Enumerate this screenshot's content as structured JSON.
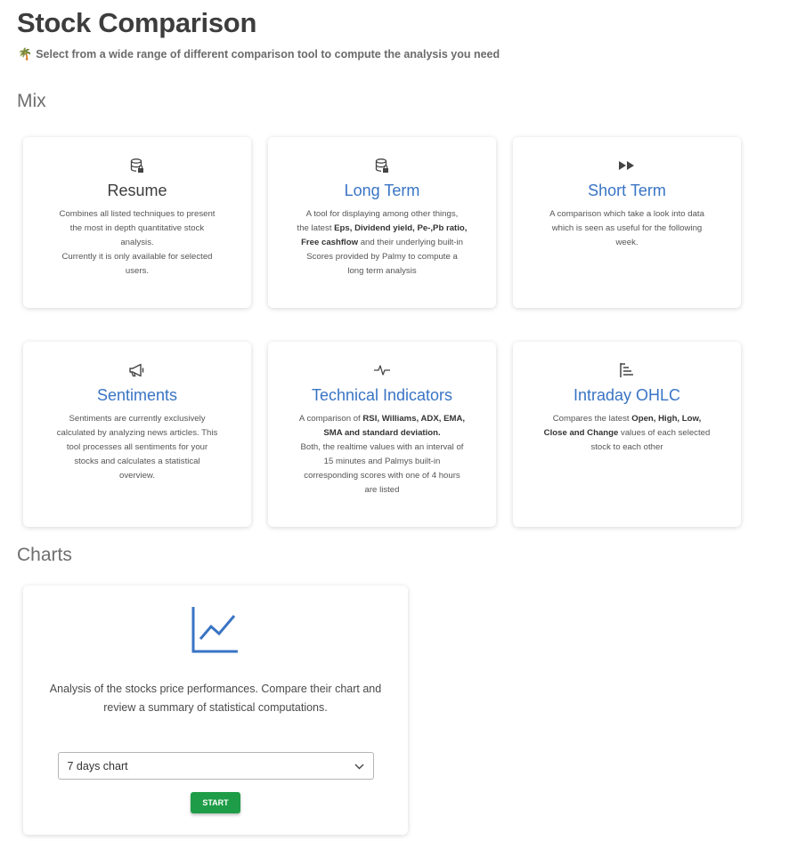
{
  "header": {
    "title": "Stock Comparison",
    "subtitle": "Select from a wide range of different comparison tool to compute the analysis you need"
  },
  "sections": {
    "mix": "Mix",
    "charts": "Charts"
  },
  "mix_cards": [
    {
      "icon": "database-lock-icon",
      "title": "Resume",
      "description_lines": [
        "Combines all listed techniques to present",
        "the most in depth quantitative stock",
        "analysis.",
        "Currently it is only available for selected",
        "users."
      ]
    },
    {
      "icon": "database-lock-icon",
      "title": "Long Term",
      "description_parts": [
        "A tool for displaying among other things,",
        "the latest",
        "Eps, Dividend yield, Pe-,Pb ratio,",
        "Free cashflow",
        "and their underlying built-in",
        "Scores provided by Palmy to compute a",
        "long term analysis"
      ]
    },
    {
      "icon": "fast-forward-icon",
      "title": "Short Term",
      "description_lines": [
        "A comparison which take a look into data",
        "which is seen as useful for the following",
        "week."
      ]
    },
    {
      "icon": "megaphone-icon",
      "title": "Sentiments",
      "description_lines": [
        "Sentiments are currently exclusively",
        "calculated by analyzing news articles. This",
        "tool processes all sentiments for your",
        "stocks and calculates a statistical",
        "overview."
      ]
    },
    {
      "icon": "pulse-icon",
      "title": "Technical Indicators",
      "description_parts": [
        "A comparison of",
        "RSI, Williams, ADX, EMA,",
        "SMA and standard deviation.",
        "Both, the realtime values with an interval of",
        "15 minutes and Palmys built-in",
        "corresponding scores with one of 4 hours",
        "are listed"
      ]
    },
    {
      "icon": "ohlc-bars-icon",
      "title": "Intraday OHLC",
      "description_parts": [
        "Compares the latest",
        "Open, High, Low,",
        "Close and Change",
        "values of each selected",
        "stock to each other"
      ]
    }
  ],
  "chart_card": {
    "icon": "line-chart-icon",
    "description": "Analysis of the stocks price performances. Compare their chart and review a summary of statistical computations.",
    "select_value": "7 days chart",
    "start_label": "START"
  },
  "colors": {
    "accent": "#3974c4",
    "title": "#3d3d3d",
    "button": "#1e9c47"
  }
}
